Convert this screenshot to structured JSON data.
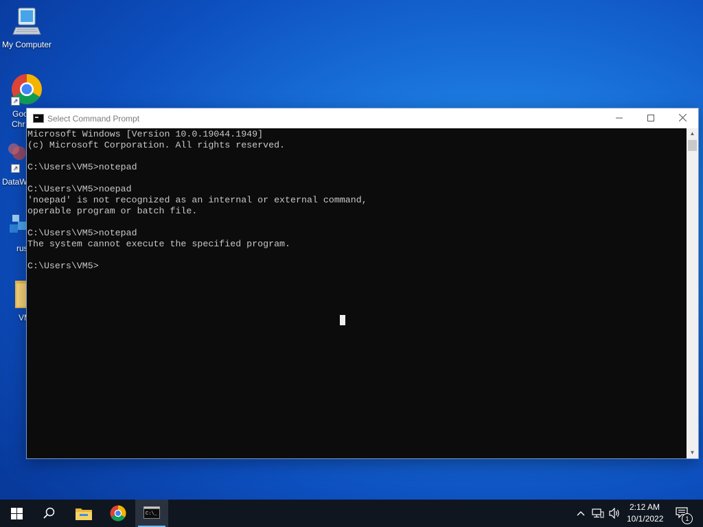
{
  "desktop": {
    "icons": [
      {
        "label": "My Computer"
      },
      {
        "label": "Goo"
      },
      {
        "label": "Chr"
      },
      {
        "label": "DataW"
      },
      {
        "label": "rus"
      },
      {
        "label": "VM"
      }
    ]
  },
  "window": {
    "title": "Select Command Prompt",
    "console_lines": [
      "Microsoft Windows [Version 10.0.19044.1949]",
      "(c) Microsoft Corporation. All rights reserved.",
      "",
      "C:\\Users\\VM5>notepad",
      "",
      "C:\\Users\\VM5>noepad",
      "'noepad' is not recognized as an internal or external command,",
      "operable program or batch file.",
      "",
      "C:\\Users\\VM5>notepad",
      "The system cannot execute the specified program.",
      "",
      "C:\\Users\\VM5>"
    ]
  },
  "taskbar": {
    "clock_time": "2:12 AM",
    "clock_date": "10/1/2022",
    "notification_count": "1"
  }
}
